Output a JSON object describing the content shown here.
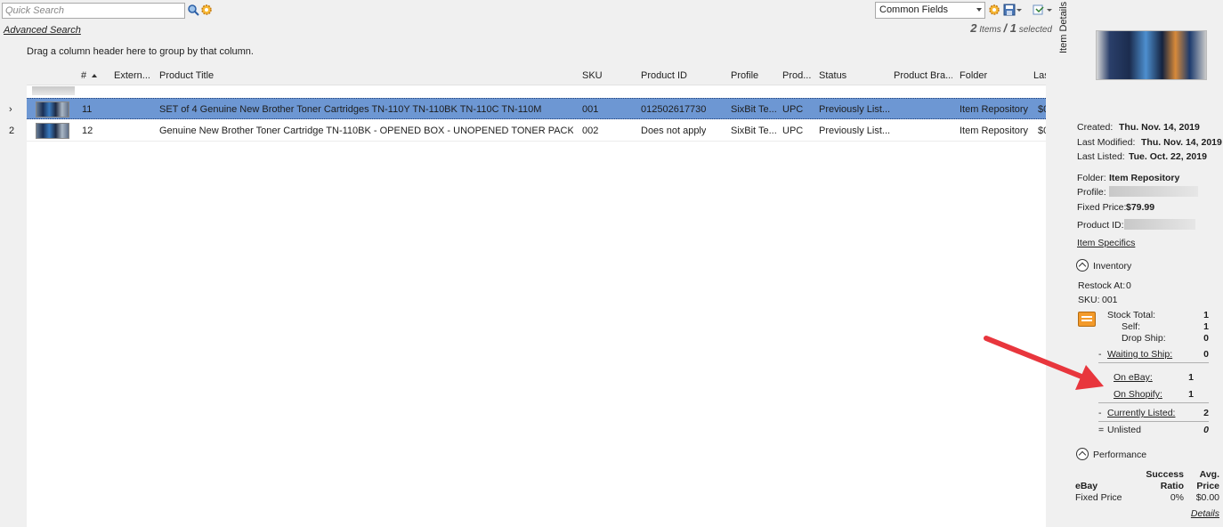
{
  "toolbar": {
    "search_placeholder": "Quick Search",
    "advanced_search": "Advanced Search",
    "fields_select": "Common Fields",
    "count_items": "2",
    "items_label": "Items",
    "count_selected": "1",
    "selected_label": "selected"
  },
  "grid": {
    "group_hint": "Drag a column header here to group by that column.",
    "headers": {
      "num": "#",
      "external": "Extern...",
      "title": "Product Title",
      "sku": "SKU",
      "product_id": "Product ID",
      "profile": "Profile",
      "prod": "Prod...",
      "status": "Status",
      "brand": "Product Bra...",
      "folder": "Folder",
      "last": "Las"
    },
    "row_indicators": [
      "›",
      "2"
    ],
    "rows": [
      {
        "num": "11",
        "title": "SET of 4 Genuine New Brother Toner Cartridges TN-110Y TN-110BK TN-110C TN-110M",
        "sku": "001",
        "product_id": "012502617730",
        "profile": "SixBit Te...",
        "prod": "UPC",
        "status": "Previously List...",
        "folder": "Item Repository",
        "last": "$0"
      },
      {
        "num": "12",
        "title": "Genuine New Brother Toner Cartridge TN-110BK - OPENED BOX - UNOPENED TONER PACK",
        "sku": "002",
        "product_id": "Does not apply",
        "profile": "SixBit Te...",
        "prod": "UPC",
        "status": "Previously List...",
        "folder": "Item Repository",
        "last": "$0"
      }
    ]
  },
  "details": {
    "tab_label": "Item Details",
    "created_label": "Created:",
    "created": "Thu. Nov. 14, 2019",
    "modified_label": "Last Modified:",
    "modified": "Thu. Nov. 14, 2019",
    "listed_label": "Last Listed:",
    "listed": "Tue. Oct. 22, 2019",
    "folder_label": "Folder:",
    "folder": "Item Repository",
    "profile_label": "Profile:",
    "price_label": "Fixed Price:",
    "price": "$79.99",
    "product_id_label": "Product ID:",
    "item_specifics": "Item Specifics",
    "inventory": {
      "header": "Inventory",
      "restock_label": "Restock At:",
      "restock": "0",
      "sku_label": "SKU:",
      "sku": "001",
      "stock_total_label": "Stock Total:",
      "stock_total": "1",
      "self_label": "Self:",
      "self": "1",
      "drop_ship_label": "Drop Ship:",
      "drop_ship": "0",
      "minus1": "-",
      "waiting_label": "Waiting to Ship:",
      "waiting": "0",
      "on_ebay_label": "On eBay:",
      "on_ebay": "1",
      "on_shopify_label": "On Shopify:",
      "on_shopify": "1",
      "minus2": "-",
      "currently_listed_label": "Currently Listed:",
      "currently_listed": "2",
      "equals": "=",
      "unlisted_label": "Unlisted",
      "unlisted": "0"
    },
    "performance": {
      "header": "Performance",
      "col_success_1": "Success",
      "col_success_2": "Ratio",
      "col_avg_1": "Avg.",
      "col_avg_2": "Price",
      "ebay_label": "eBay",
      "fixed_label": "Fixed Price",
      "ratio": "0%",
      "avg": "$0.00",
      "details_link": "Details"
    }
  },
  "colors": {
    "selection": "#6d97d3",
    "annotation_arrow": "#e8363d",
    "inventory_icon": "#f39a2a"
  }
}
